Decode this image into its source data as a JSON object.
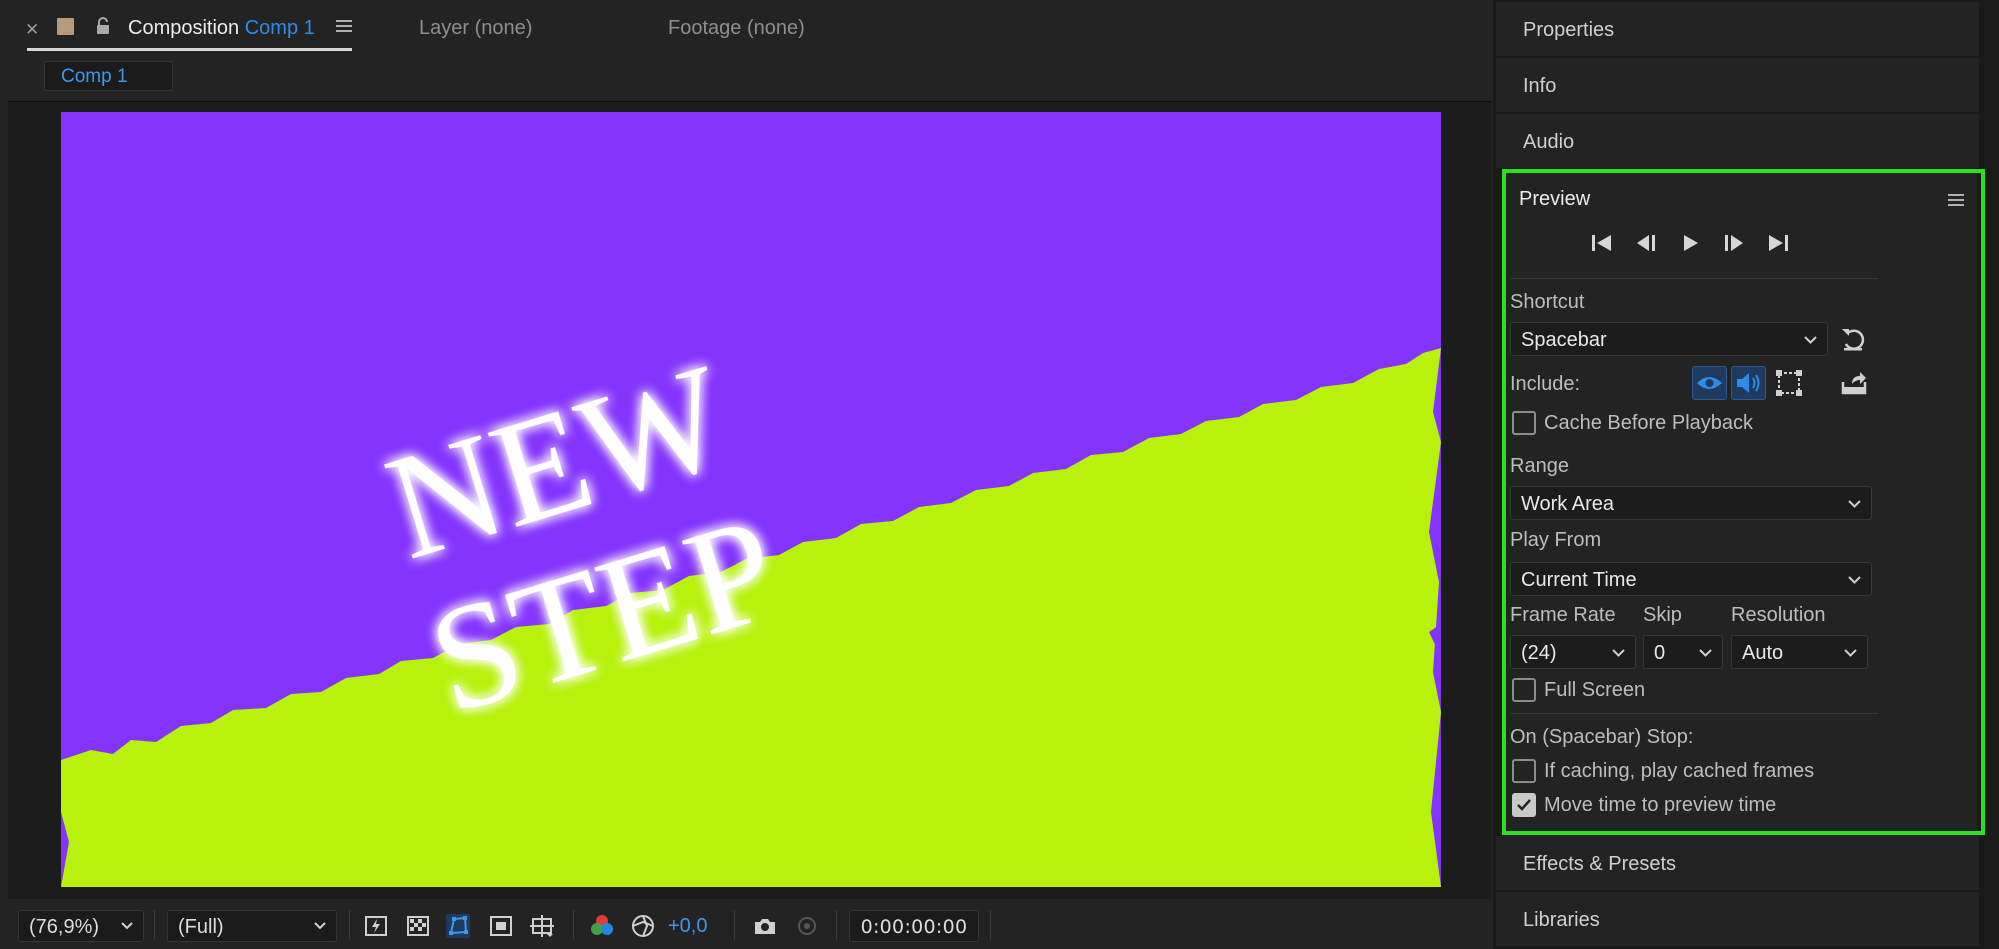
{
  "composition_panel": {
    "tab_prefix": "Composition",
    "comp_name": "Comp 1",
    "layer_tab": "Layer (none)",
    "footage_tab": "Footage (none)",
    "breadcrumb": "Comp 1",
    "canvas_text_line1": "NEW",
    "canvas_text_line2": "STEP",
    "colors": {
      "background": "#8434fd",
      "ground": "#b6f20b",
      "text": "#ffffff"
    }
  },
  "viewer_toolbar": {
    "magnification": "(76,9%)",
    "resolution": "(Full)",
    "exposure": "+0,0",
    "timecode": "0:00:00:00"
  },
  "right_panels": {
    "properties": "Properties",
    "info": "Info",
    "audio": "Audio",
    "effects_presets": "Effects & Presets",
    "libraries": "Libraries"
  },
  "preview": {
    "title": "Preview",
    "shortcut_label": "Shortcut",
    "shortcut_value": "Spacebar",
    "include_label": "Include:",
    "cache_before_playback": {
      "label": "Cache Before Playback",
      "checked": false
    },
    "range_label": "Range",
    "range_value": "Work Area",
    "play_from_label": "Play From",
    "play_from_value": "Current Time",
    "frame_rate_label": "Frame Rate",
    "frame_rate_value": "(24)",
    "skip_label": "Skip",
    "skip_value": "0",
    "resolution_label": "Resolution",
    "resolution_value": "Auto",
    "full_screen": {
      "label": "Full Screen",
      "checked": false
    },
    "on_stop_label": "On (Spacebar) Stop:",
    "if_caching": {
      "label": "If caching, play cached frames",
      "checked": false
    },
    "move_time": {
      "label": "Move time to preview time",
      "checked": true
    },
    "highlight_color": "#27e31f",
    "accent_color": "#2d8ceb"
  }
}
